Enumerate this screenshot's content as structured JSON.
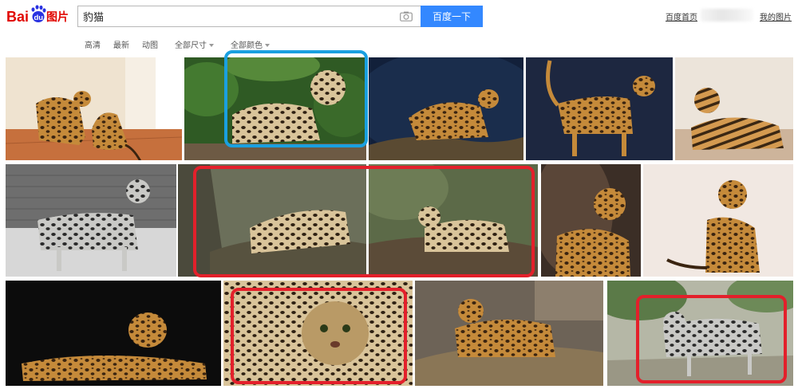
{
  "logo": {
    "text_bai": "Bai",
    "text_du": "du",
    "text_tupian": "图片"
  },
  "search": {
    "query": "豹猫",
    "button_label": "百度一下"
  },
  "top_links": {
    "home": "百度首页",
    "mine": "我的图片"
  },
  "filters": [
    {
      "label": "高清",
      "has_dropdown": false
    },
    {
      "label": "最新",
      "has_dropdown": false
    },
    {
      "label": "动图",
      "has_dropdown": false
    },
    {
      "label": "全部尺寸",
      "has_dropdown": true
    },
    {
      "label": "全部颜色",
      "has_dropdown": true
    }
  ],
  "colors": {
    "accent": "#3388ff",
    "logo_red": "#e10601",
    "logo_blue": "#2932e1",
    "highlight_blue": "#1aa0e0",
    "highlight_red": "#e3202b"
  },
  "results": [
    {
      "row": 1,
      "subject": "two spotted bengal cats in a room"
    },
    {
      "row": 1,
      "subject": "ocelot-like wild cat in green foliage"
    },
    {
      "row": 1,
      "subject": "cat crouching on log, dark background"
    },
    {
      "row": 1,
      "subject": "bengal cat walking, dark blue background"
    },
    {
      "row": 1,
      "subject": "bengal cat lying on wooden floor"
    },
    {
      "row": 2,
      "subject": "silver bengal cat by brick wall"
    },
    {
      "row": 2,
      "subject": "ocelot on tree branch"
    },
    {
      "row": 2,
      "subject": "ocelot resting on log"
    },
    {
      "row": 2,
      "subject": "bengal kitten in brown chair"
    },
    {
      "row": 2,
      "subject": "bengal cat sitting, light background"
    },
    {
      "row": 3,
      "subject": "bengal cat lying, black background"
    },
    {
      "row": 3,
      "subject": "ocelot close-up face"
    },
    {
      "row": 3,
      "subject": "bengal cat on driftwood"
    },
    {
      "row": 3,
      "subject": "wild cat walking on rocks"
    }
  ]
}
